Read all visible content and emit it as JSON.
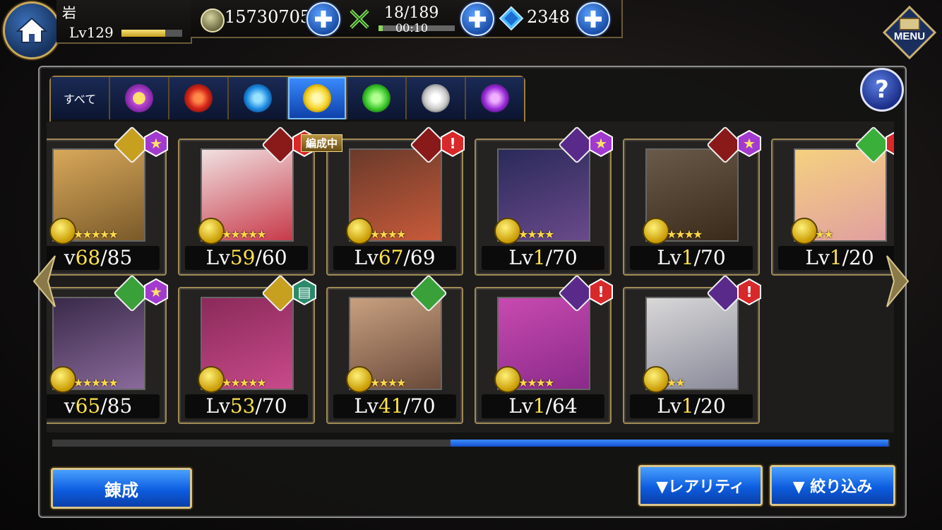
{
  "header": {
    "player_name": "岩",
    "level_label": "Lv129",
    "exp_ratio": 0.72,
    "gold": "15730705",
    "stamina": "18/189",
    "stamina_timer": "00:10",
    "gems": "2348",
    "menu_label": "MENU"
  },
  "tabs": {
    "all_label": "すべて",
    "items": [
      "star",
      "fire",
      "water",
      "thunder",
      "wind",
      "light",
      "dark"
    ],
    "active": "thunder"
  },
  "help_label": "?",
  "in_party_label": "編成中",
  "cards": [
    {
      "lv_prefix": "v",
      "lv_cur": "68",
      "lv_max": "/85",
      "stars": "★★★★★",
      "status": "star"
    },
    {
      "lv_prefix": "Lv",
      "lv_cur": "59",
      "lv_max": "/60",
      "stars": "★★★★★",
      "status": "alert"
    },
    {
      "lv_prefix": "Lv",
      "lv_cur": "67",
      "lv_max": "/69",
      "stars": "★★★★",
      "status": "alert"
    },
    {
      "lv_prefix": "Lv",
      "lv_cur": "1",
      "lv_max": "/70",
      "stars": "★★★★",
      "status": "star"
    },
    {
      "lv_prefix": "Lv",
      "lv_cur": "1",
      "lv_max": "/70",
      "stars": "★★★★",
      "status": "star"
    },
    {
      "lv_prefix": "Lv",
      "lv_cur": "1",
      "lv_max": "/20",
      "stars": "★★",
      "status": "alert"
    },
    {
      "lv_prefix": "v",
      "lv_cur": "65",
      "lv_max": "/85",
      "stars": "★★★★★",
      "status": "star"
    },
    {
      "lv_prefix": "Lv",
      "lv_cur": "53",
      "lv_max": "/70",
      "stars": "★★★★★",
      "status": "book"
    },
    {
      "lv_prefix": "Lv",
      "lv_cur": "41",
      "lv_max": "/70",
      "stars": "★★★★",
      "status": "none"
    },
    {
      "lv_prefix": "Lv",
      "lv_cur": "1",
      "lv_max": "/64",
      "stars": "★★★★",
      "status": "alert"
    },
    {
      "lv_prefix": "Lv",
      "lv_cur": "1",
      "lv_max": "/20",
      "stars": "★★",
      "status": "alert"
    }
  ],
  "buttons": {
    "refine": "錬成",
    "rarity": "▼レアリティ",
    "filter": "▼ 絞り込み"
  },
  "colors": {
    "accent_blue": "#1a5ee0",
    "gold_frame": "#a08a55",
    "level_highlight": "#ffe34a",
    "alert_red": "#d8282a",
    "star_purple": "#a23ad0"
  }
}
